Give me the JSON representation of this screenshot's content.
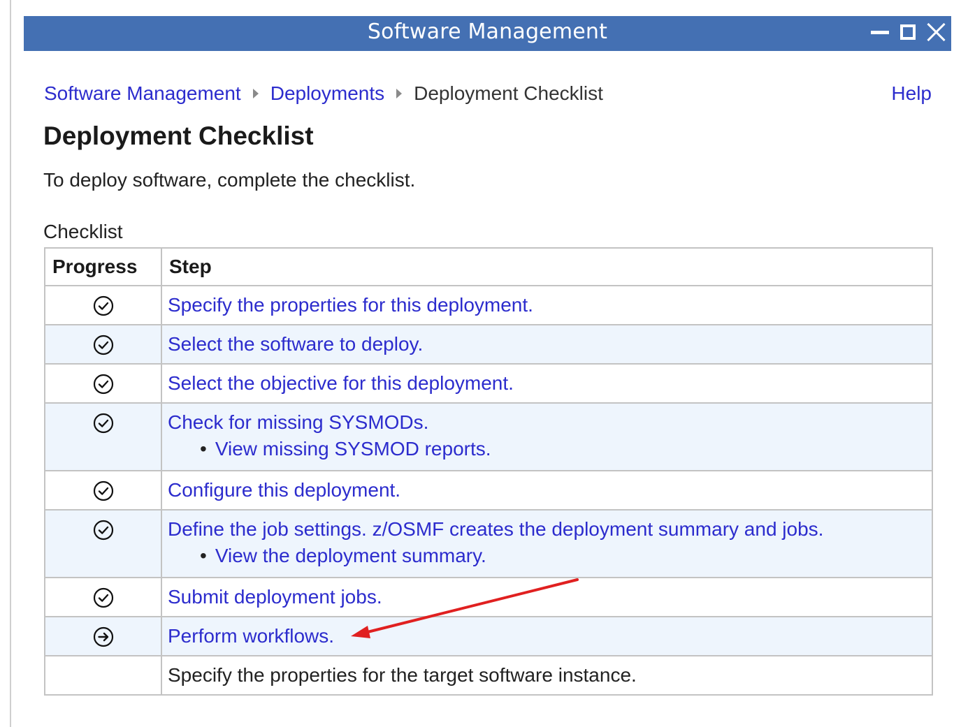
{
  "window": {
    "title": "Software Management"
  },
  "breadcrumb": {
    "items": [
      {
        "label": "Software Management",
        "link": true
      },
      {
        "label": "Deployments",
        "link": true
      },
      {
        "label": "Deployment Checklist",
        "link": false
      }
    ],
    "help_label": "Help"
  },
  "page": {
    "title": "Deployment Checklist",
    "intro": "To deploy software, complete the checklist."
  },
  "checklist": {
    "caption": "Checklist",
    "headers": {
      "progress": "Progress",
      "step": "Step"
    },
    "rows": [
      {
        "status": "complete",
        "icon": "check-circle-icon",
        "step": "Specify the properties for this deployment.",
        "link": true,
        "sub": null
      },
      {
        "status": "complete",
        "icon": "check-circle-icon",
        "step": "Select the software to deploy.",
        "link": true,
        "sub": null
      },
      {
        "status": "complete",
        "icon": "check-circle-icon",
        "step": "Select the objective for this deployment.",
        "link": true,
        "sub": null
      },
      {
        "status": "complete",
        "icon": "check-circle-icon",
        "step": "Check for missing SYSMODs.",
        "link": true,
        "sub": "View missing SYSMOD reports."
      },
      {
        "status": "complete",
        "icon": "check-circle-icon",
        "step": "Configure this deployment.",
        "link": true,
        "sub": null
      },
      {
        "status": "complete",
        "icon": "check-circle-icon",
        "step": "Define the job settings. z/OSMF creates the deployment summary and jobs.",
        "link": true,
        "sub": "View the deployment summary."
      },
      {
        "status": "complete",
        "icon": "check-circle-icon",
        "step": "Submit deployment jobs.",
        "link": true,
        "sub": null
      },
      {
        "status": "current",
        "icon": "arrow-circle-icon",
        "step": "Perform workflows.",
        "link": true,
        "sub": null
      },
      {
        "status": "pending",
        "icon": "",
        "step": "Specify the properties for the target software instance.",
        "link": false,
        "sub": null
      }
    ]
  },
  "colors": {
    "titlebar": "#4470b3",
    "link": "#2c2ccd",
    "row_alt": "#eef5fd",
    "annotation_arrow": "#e02020"
  }
}
